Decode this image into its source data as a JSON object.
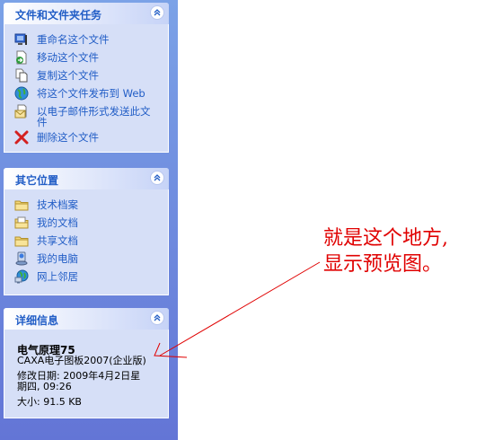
{
  "file_tasks": {
    "title": "文件和文件夹任务",
    "items": [
      {
        "label": "重命名这个文件",
        "icon": "rename-icon"
      },
      {
        "label": "移动这个文件",
        "icon": "move-icon"
      },
      {
        "label": "复制这个文件",
        "icon": "copy-icon"
      },
      {
        "label": "将这个文件发布到 Web",
        "icon": "publish-web-icon"
      },
      {
        "label": "以电子邮件形式发送此文件",
        "icon": "email-icon"
      },
      {
        "label": "删除这个文件",
        "icon": "delete-icon"
      }
    ]
  },
  "other_places": {
    "title": "其它位置",
    "items": [
      {
        "label": "技术档案",
        "icon": "folder-icon"
      },
      {
        "label": "我的文档",
        "icon": "my-documents-icon"
      },
      {
        "label": "共享文档",
        "icon": "folder-icon"
      },
      {
        "label": "我的电脑",
        "icon": "my-computer-icon"
      },
      {
        "label": "网上邻居",
        "icon": "network-icon"
      }
    ]
  },
  "details": {
    "title": "详细信息",
    "file_name": "电气原理75",
    "file_type": "CAXA电子图板2007(企业版)",
    "modified_line1": "修改日期: 2009年4月2日星",
    "modified_line2": "期四, 09:26",
    "size": "大小: 91.5 KB"
  },
  "annotation": {
    "line1": "就是这个地方,",
    "line2": "显示预览图。",
    "color": "#e00000"
  },
  "colors": {
    "link": "#215dc6",
    "panel_bg": "#d6dff7",
    "pane_bg_top": "#7ba2e7",
    "pane_bg_bottom": "#6375d6"
  }
}
